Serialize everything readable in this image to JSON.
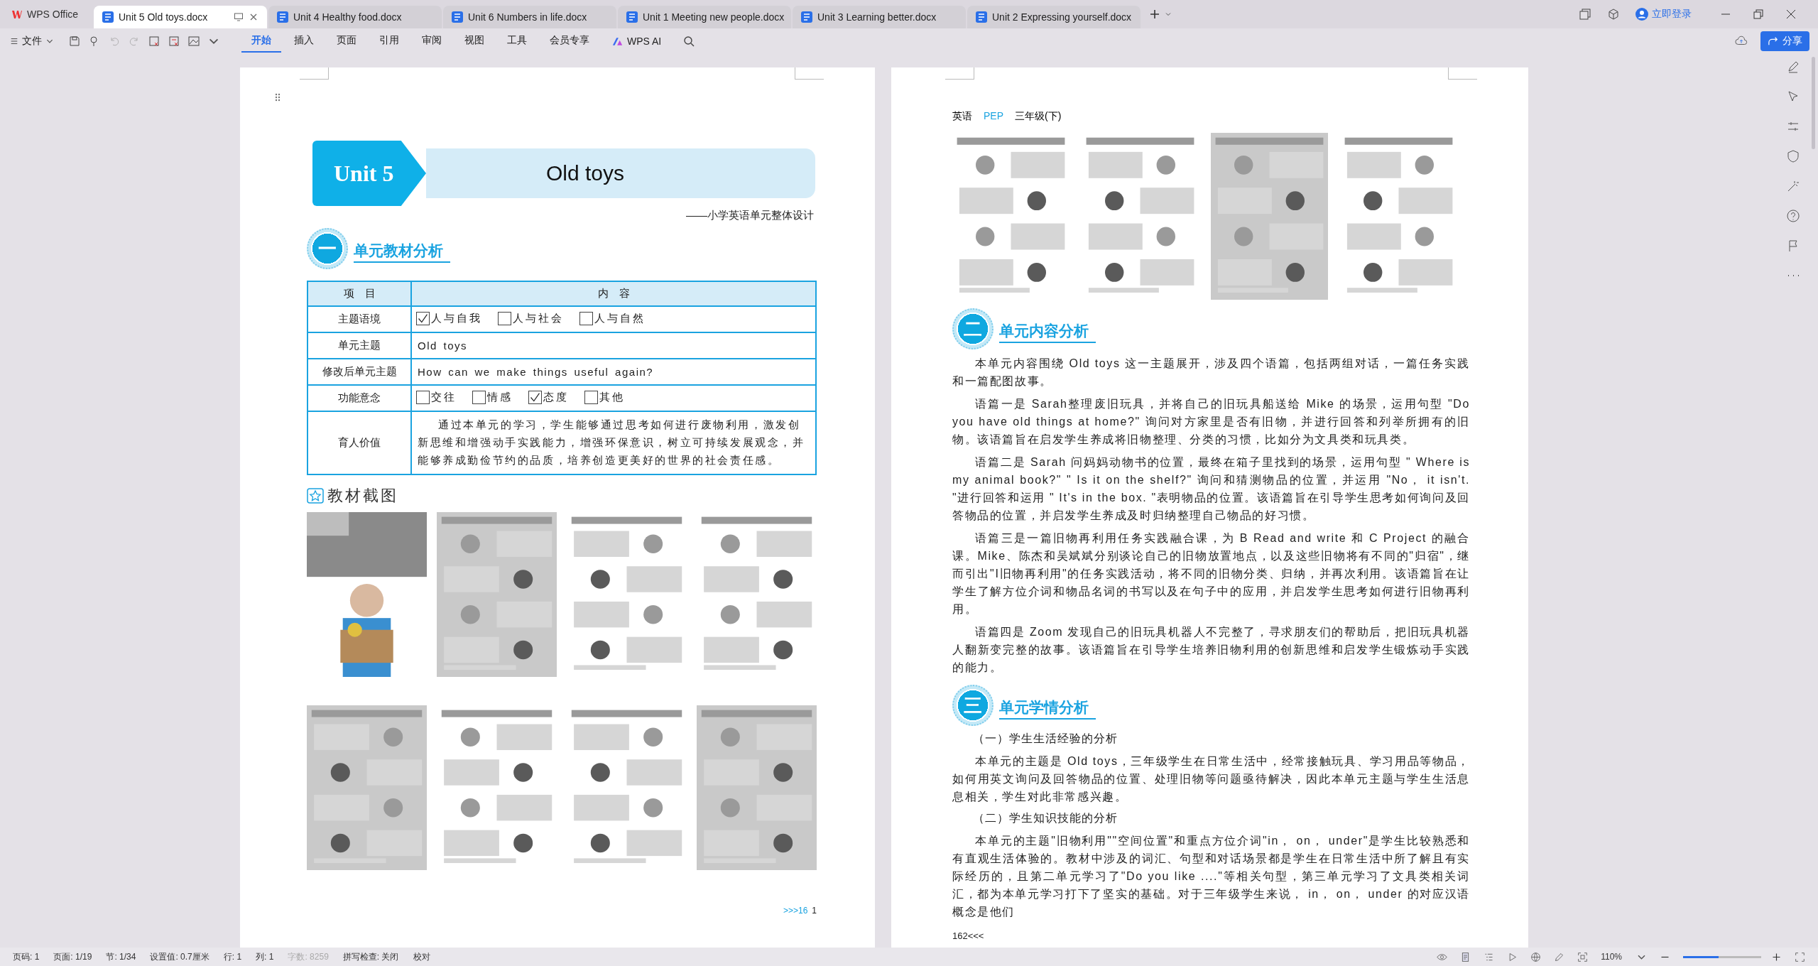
{
  "title_bar": {
    "app_tab": "WPS Office",
    "tabs": [
      {
        "label": "Unit 5 Old toys.docx",
        "selected": true
      },
      {
        "label": "Unit 4 Healthy food.docx",
        "selected": false
      },
      {
        "label": "Unit 6 Numbers in life.docx",
        "selected": false
      },
      {
        "label": "Unit 1 Meeting new people.docx",
        "selected": false
      },
      {
        "label": "Unit 3 Learning better.docx",
        "selected": false
      },
      {
        "label": "Unit 2 Expressing yourself.docx",
        "selected": false
      }
    ],
    "login": "立即登录"
  },
  "toolbar": {
    "file_menu": "文件",
    "ribbon_tabs": [
      {
        "label": "开始",
        "selected": true
      },
      {
        "label": "插入",
        "selected": false
      },
      {
        "label": "页面",
        "selected": false
      },
      {
        "label": "引用",
        "selected": false
      },
      {
        "label": "审阅",
        "selected": false
      },
      {
        "label": "视图",
        "selected": false
      },
      {
        "label": "工具",
        "selected": false
      },
      {
        "label": "会员专享",
        "selected": false
      }
    ],
    "ai": "WPS AI",
    "share": "分享"
  },
  "left_page": {
    "unit_badge": "Unit 5",
    "unit_title": "Old toys",
    "subtitle": "——小学英语单元整体设计",
    "section": {
      "number": "一",
      "title": "单元教材分析"
    },
    "table": {
      "columns": [
        "项　目",
        "内　容"
      ],
      "rows": [
        {
          "label": "主题语境",
          "kind": "checks",
          "options": [
            {
              "label": "人与自我",
              "checked": true
            },
            {
              "label": "人与社会",
              "checked": false
            },
            {
              "label": "人与自然",
              "checked": false
            }
          ]
        },
        {
          "label": "单元主题",
          "kind": "text",
          "text": "Old toys"
        },
        {
          "label": "修改后单元主题",
          "kind": "text",
          "text": "How can we make things useful again?"
        },
        {
          "label": "功能意念",
          "kind": "checks",
          "options": [
            {
              "label": "交往",
              "checked": false
            },
            {
              "label": "情感",
              "checked": false
            },
            {
              "label": "态度",
              "checked": true
            },
            {
              "label": "其他",
              "checked": false
            }
          ]
        },
        {
          "label": "育人价值",
          "kind": "paragraph",
          "text": "通过本单元的学习，学生能够通过思考如何进行废物利用，激发创新思维和增强动手实践能力，增强环保意识，树立可持续发展观念，并能够养成勤俭节约的品质，培养创造更美好的世界的社会责任感。"
        }
      ]
    },
    "screenshots_heading": "教材截图",
    "footer": {
      "arrows": ">>>16",
      "page": "1"
    }
  },
  "right_page": {
    "header": [
      {
        "text": "英语",
        "color": "#000000"
      },
      {
        "text": "PEP",
        "color": "#1aa3e0"
      },
      {
        "text": "三年级(下)",
        "color": "#000000"
      }
    ],
    "blocks": [
      {
        "kind": "heading",
        "number": "二",
        "title": "单元内容分析"
      },
      {
        "kind": "paragraph",
        "text": "本单元内容围绕 Old toys 这一主题展开，涉及四个语篇，包括两组对话，一篇任务实践和一篇配图故事。"
      },
      {
        "kind": "paragraph",
        "text": "语篇一是 Sarah整理废旧玩具，并将自己的旧玩具船送给 Mike 的场景，运用句型 \"Do you have old things at home?\" 询问对方家里是否有旧物，并进行回答和列举所拥有的旧物。该语篇旨在启发学生养成将旧物整理、分类的习惯，比如分为文具类和玩具类。"
      },
      {
        "kind": "paragraph",
        "text": "语篇二是 Sarah 问妈妈动物书的位置，最终在箱子里找到的场景，运用句型 \" Where is my animal book?\" \" Is it on the shelf?\" 询问和猜测物品的位置，并运用 \"No， it isn't. \"进行回答和运用 \" It's in the box. \"表明物品的位置。该语篇旨在引导学生思考如何询问及回答物品的位置，并启发学生养成及时归纳整理自己物品的好习惯。"
      },
      {
        "kind": "paragraph",
        "text": "语篇三是一篇旧物再利用任务实践融合课，为 B Read and write 和 C Project 的融合课。Mike、陈杰和吴斌斌分别谈论自己的旧物放置地点，以及这些旧物将有不同的\"归宿\"，继而引出\"I旧物再利用\"的任务实践活动，将不同的旧物分类、归纳，并再次利用。该语篇旨在让学生了解方位介词和物品名词的书写以及在句子中的应用，并启发学生思考如何进行旧物再利用。"
      },
      {
        "kind": "paragraph",
        "text": "语篇四是 Zoom 发现自己的旧玩具机器人不完整了，寻求朋友们的帮助后，把旧玩具机器人翻新变完整的故事。该语篇旨在引导学生培养旧物利用的创新思维和启发学生锻炼动手实践的能力。"
      },
      {
        "kind": "heading",
        "number": "三",
        "title": "单元学情分析"
      },
      {
        "kind": "subheading",
        "text": "（一）学生生活经验的分析"
      },
      {
        "kind": "paragraph",
        "text": "本单元的主题是 Old toys，三年级学生在日常生活中，经常接触玩具、学习用品等物品，如何用英文询问及回答物品的位置、处理旧物等问题亟待解决，因此本单元主题与学生生活息息相关，学生对此非常感兴趣。"
      },
      {
        "kind": "subheading",
        "text": "（二）学生知识技能的分析"
      },
      {
        "kind": "paragraph",
        "text": "本单元的主题\"旧物利用\"\"空间位置\"和重点方位介词\"in， on， under\"是学生比较熟悉和有直观生活体验的。教材中涉及的词汇、句型和对话场景都是学生在日常生活中所了解且有实际经历的，且第二单元学习了\"Do you like ....\"等相关句型，第三单元学习了文具类相关词汇，都为本单元学习打下了坚实的基础。对于三年级学生来说， in， on， under 的对应汉语概念是他们"
      }
    ],
    "footer": "162<<<"
  },
  "status_bar": {
    "items": [
      {
        "text": "页码: 1",
        "disabled": false
      },
      {
        "text": "页面: 1/19",
        "disabled": false
      },
      {
        "text": "节: 1/34",
        "disabled": false
      },
      {
        "text": "设置值: 0.7厘米",
        "disabled": false
      },
      {
        "text": "行: 1",
        "disabled": false
      },
      {
        "text": "列: 1",
        "disabled": false
      },
      {
        "text": "字数: 8259",
        "disabled": true
      }
    ],
    "spell_check": "拼写检查: 关闭",
    "proofread": "校对",
    "zoom": "110%",
    "zoom_slider": {
      "level": 0.45
    }
  }
}
